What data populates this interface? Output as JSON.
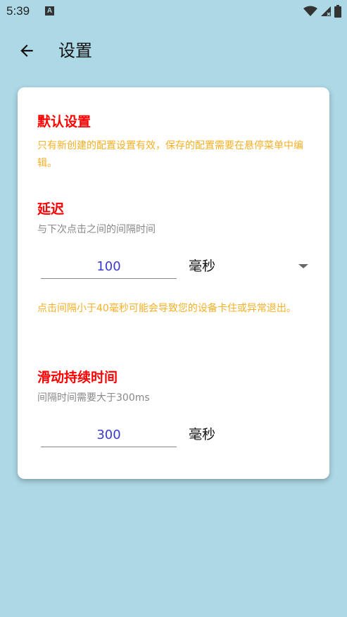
{
  "status_bar": {
    "time": "5:39",
    "notification_icon_letter": "A"
  },
  "app_bar": {
    "title": "设置"
  },
  "default_settings": {
    "title": "默认设置",
    "description": "只有新创建的配置设置有效，保存的配置需要在悬停菜单中编辑。"
  },
  "delay": {
    "title": "延迟",
    "subtitle": "与下次点击之间的间隔时间",
    "value": "100",
    "unit": "毫秒",
    "warning": "点击间隔小于40毫秒可能会导致您的设备卡住或异常退出。"
  },
  "swipe_duration": {
    "title": "滑动持续时间",
    "subtitle": "间隔时间需要大于300ms",
    "value": "300",
    "unit": "毫秒"
  },
  "colors": {
    "background": "#ADD8E6",
    "title_red": "#FF0000",
    "warning_orange": "#F5B026",
    "input_text": "#3A3AD0"
  }
}
